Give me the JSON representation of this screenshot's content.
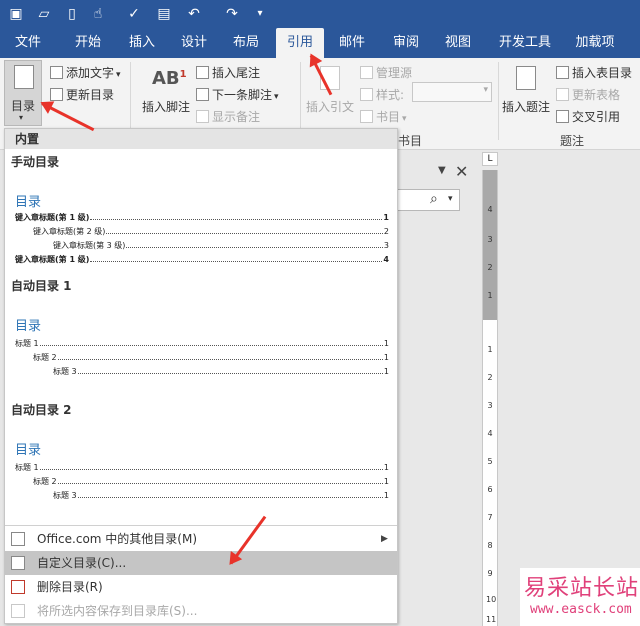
{
  "qat": {
    "icons": [
      "save-icon",
      "open-folder-icon",
      "new-document-icon",
      "touch-mode-icon",
      "spelling-check-icon",
      "print-preview-icon",
      "undo-icon",
      "redo-icon",
      "customize-qat-icon"
    ]
  },
  "tabs": [
    "文件",
    "开始",
    "插入",
    "设计",
    "布局",
    "引用",
    "邮件",
    "审阅",
    "视图",
    "开发工具",
    "加载项"
  ],
  "ribbon": {
    "toc_button": "目录",
    "add_text": "添加文字",
    "update_toc": "更新目录",
    "insert_footnote": "插入脚注",
    "footnote_glyph": "AB",
    "footnote_sup": "1",
    "insert_endnote": "插入尾注",
    "next_footnote": "下一条脚注",
    "show_notes": "显示备注",
    "insert_citation": "插入引文",
    "manage_sources": "管理源",
    "style": "样式:",
    "bibliography": "书目",
    "group_citations_tail": "书目",
    "insert_caption": "插入题注",
    "insert_table_of_figures": "插入表目录",
    "update_table": "更新表格",
    "cross_reference": "交叉引用",
    "group_captions": "题注"
  },
  "menu": {
    "header": "内置",
    "manual": {
      "title": "手动目录",
      "heading": "目录",
      "lines": [
        {
          "text": "键入章标题(第 1 级)",
          "page": "1"
        },
        {
          "text": "键入章标题(第 2 级)",
          "page": "2"
        },
        {
          "text": "键入章标题(第 3 级)",
          "page": "3"
        },
        {
          "text": "键入章标题(第 1 级)",
          "page": "4"
        }
      ]
    },
    "auto1": {
      "title": "自动目录 1",
      "heading": "目录",
      "lines": [
        {
          "text": "标题 1",
          "page": "1"
        },
        {
          "text": "标题 2",
          "page": "1"
        },
        {
          "text": "标题 3",
          "page": "1"
        }
      ]
    },
    "auto2": {
      "title": "自动目录 2",
      "heading": "目录",
      "lines": [
        {
          "text": "标题 1",
          "page": "1"
        },
        {
          "text": "标题 2",
          "page": "1"
        },
        {
          "text": "标题 3",
          "page": "1"
        }
      ]
    },
    "items": {
      "office_more": "Office.com 中的其他目录(M)",
      "custom_toc": "自定义目录(C)...",
      "remove_toc": "删除目录(R)",
      "save_selection": "将所选内容保存到目录库(S)..."
    }
  },
  "ruler_numbers": [
    "4",
    "3",
    "2",
    "1",
    "1",
    "2",
    "3",
    "4",
    "5",
    "6",
    "7",
    "8",
    "9",
    "10",
    "11"
  ],
  "ruler_corner": "L",
  "watermark": {
    "cn": "易采站长站",
    "url": "www.easck.com"
  },
  "colors": {
    "brand": "#2b579a",
    "toc_heading": "#2e74b5",
    "annotation_arrow": "#e8332a",
    "watermark": "#e0407a"
  }
}
